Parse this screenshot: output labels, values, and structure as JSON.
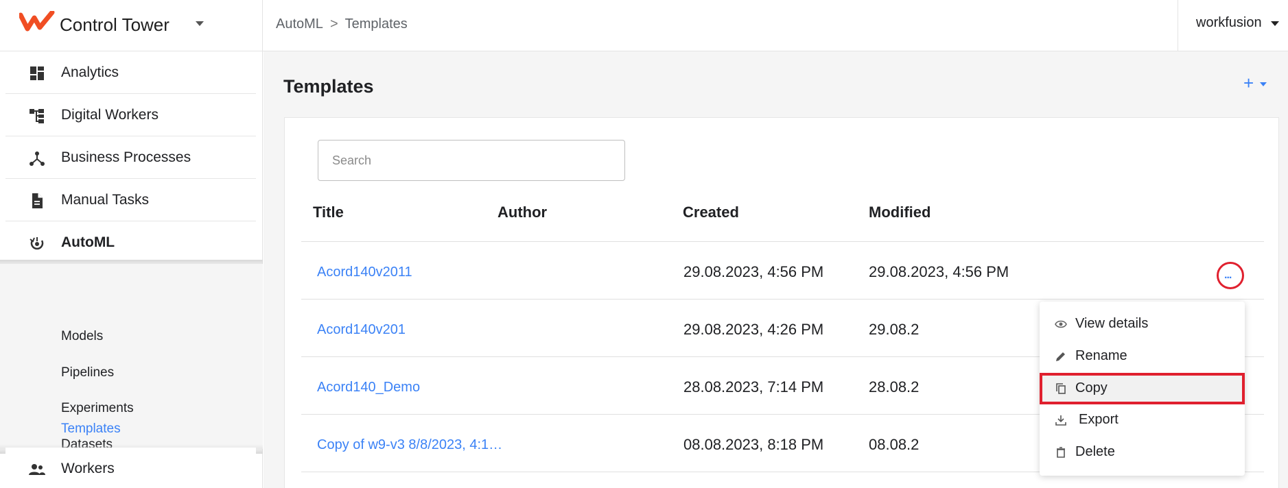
{
  "app": {
    "name": "Control Tower",
    "user": "workfusion",
    "brand_color": "#f04e23",
    "accent_color": "#3b82f6"
  },
  "breadcrumb": [
    "AutoML",
    "Templates"
  ],
  "sidebar": {
    "items": [
      {
        "label": "Analytics",
        "icon": "dashboard-icon"
      },
      {
        "label": "Digital Workers",
        "icon": "hierarchy-icon"
      },
      {
        "label": "Business Processes",
        "icon": "process-icon"
      },
      {
        "label": "Manual Tasks",
        "icon": "document-icon"
      },
      {
        "label": "AutoML",
        "icon": "automl-icon",
        "active": true
      },
      {
        "label": "Workers",
        "icon": "people-icon"
      }
    ],
    "automl_subitems": [
      {
        "label": "Models"
      },
      {
        "label": "Pipelines"
      },
      {
        "label": "Experiments"
      },
      {
        "label": "Datasets"
      },
      {
        "label": "Templates",
        "active": true
      }
    ]
  },
  "main": {
    "title": "Templates",
    "add_label": "+",
    "search": {
      "placeholder": "Search",
      "value": ""
    },
    "table": {
      "columns": [
        "Title",
        "Author",
        "Created",
        "Modified"
      ],
      "rows": [
        {
          "title": "Acord140v2011",
          "author": "",
          "created": "29.08.2023, 4:56 PM",
          "modified": "29.08.2023, 4:56 PM"
        },
        {
          "title": "Acord140v201",
          "author": "",
          "created": "29.08.2023, 4:26 PM",
          "modified": "29.08.2"
        },
        {
          "title": "Acord140_Demo",
          "author": "",
          "created": "28.08.2023, 7:14 PM",
          "modified": "28.08.2"
        },
        {
          "title": "Copy of w9-v3 8/8/2023, 4:1…",
          "author": "",
          "created": "08.08.2023, 8:18 PM",
          "modified": "08.08.2"
        }
      ]
    },
    "more_label": "...",
    "context_menu": [
      {
        "label": "View details",
        "icon": "eye-icon"
      },
      {
        "label": "Rename",
        "icon": "pencil-icon"
      },
      {
        "label": "Copy",
        "icon": "copy-icon",
        "highlighted": true
      },
      {
        "label": "Export",
        "icon": "download-icon"
      },
      {
        "label": "Delete",
        "icon": "trash-icon"
      }
    ]
  }
}
